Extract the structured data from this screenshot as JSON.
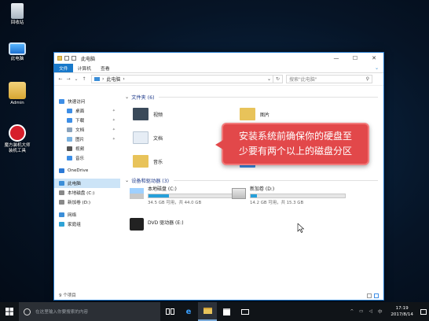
{
  "desktop": {
    "icons": [
      {
        "label": "回收站",
        "icon": "recycle-bin-icon"
      },
      {
        "label": "此电脑",
        "icon": "this-pc-icon"
      },
      {
        "label": "Admin",
        "icon": "user-folder-icon"
      },
      {
        "label": "魔方装机大师\n装机工具",
        "icon": "app-icon"
      }
    ]
  },
  "window": {
    "title": "此电脑",
    "controls": {
      "minimize": "—",
      "maximize": "☐",
      "close": "✕"
    },
    "ribbon_tabs": [
      "文件",
      "计算机",
      "查看"
    ],
    "address": {
      "path_root": "›",
      "path": "此电脑",
      "path_sep": "›"
    },
    "search_placeholder": "搜索\"此电脑\"",
    "nav": {
      "back": "←",
      "forward": "→",
      "up_dropdown": "⌄",
      "up": "↑",
      "refresh": "↻",
      "address_dropdown": "⌄",
      "search_icon": "⚲",
      "ribbon_expand": "⌄"
    },
    "sidebar": [
      {
        "label": "快速访问",
        "level": "root",
        "icon": "star-icon",
        "color": "#3d8ee6"
      },
      {
        "label": "桌面",
        "level": "sub",
        "icon": "desktop-icon",
        "color": "#3d8ee6",
        "pinned": true
      },
      {
        "label": "下载",
        "level": "sub",
        "icon": "download-icon",
        "color": "#3d8ee6",
        "pinned": true
      },
      {
        "label": "文档",
        "level": "sub",
        "icon": "document-icon",
        "color": "#8aa2bb",
        "pinned": true
      },
      {
        "label": "图片",
        "level": "sub",
        "icon": "pictures-icon",
        "color": "#7ab2e0",
        "pinned": true
      },
      {
        "label": "视频",
        "level": "sub",
        "icon": "video-icon",
        "color": "#555"
      },
      {
        "label": "音乐",
        "level": "sub",
        "icon": "music-icon",
        "color": "#3d8ee6"
      },
      {
        "label": "OneDrive",
        "level": "root",
        "icon": "cloud-icon",
        "color": "#2b79d6"
      },
      {
        "label": "此电脑",
        "level": "root",
        "icon": "computer-icon",
        "color": "#3b8ed8",
        "selected": true
      },
      {
        "label": "本地磁盘 (C:)",
        "level": "root",
        "icon": "drive-icon",
        "color": "#888"
      },
      {
        "label": "新加卷 (D:)",
        "level": "root",
        "icon": "drive-icon",
        "color": "#888"
      },
      {
        "label": "网络",
        "level": "root",
        "icon": "network-icon",
        "color": "#3b8ed8"
      },
      {
        "label": "家庭组",
        "level": "root",
        "icon": "homegroup-icon",
        "color": "#2ea3d6"
      }
    ],
    "folders_header": "文件夹 (6)",
    "folders": [
      {
        "label": "视频",
        "icon": "video-folder-icon",
        "color": "#3a4a5a"
      },
      {
        "label": "图片",
        "icon": "pictures-folder-icon",
        "color": "#e8c35a"
      },
      {
        "label": "文档",
        "icon": "documents-folder-icon",
        "color": "#e6edf5"
      },
      {
        "label": "下载",
        "icon": "downloads-folder-icon",
        "color": "#e8c35a"
      },
      {
        "label": "音乐",
        "icon": "music-folder-icon",
        "color": "#e8c35a"
      },
      {
        "label": "桌面",
        "icon": "desktop-folder-icon",
        "color": "#3d8ee6"
      }
    ],
    "drives_header": "设备和驱动器 (3)",
    "drives": [
      {
        "name": "本地磁盘 (C:)",
        "size": "34.5 GB 可用，共 44.0 GB",
        "used_fraction": 0.22,
        "icon": "windows-drive-icon"
      },
      {
        "name": "新加卷 (D:)",
        "size": "14.2 GB 可用，共 15.3 GB",
        "used_fraction": 0.07,
        "icon": "drive-icon"
      },
      {
        "name": "DVD 驱动器 (E:)",
        "icon": "dvd-drive-icon"
      }
    ],
    "status": "9 个项目"
  },
  "overlay": {
    "line1": "安装系统前确保你的硬盘至",
    "line2": "少要有两个以上的磁盘分区"
  },
  "taskbar": {
    "search_placeholder": "在这里输入你要搜索的内容",
    "time": "17:19",
    "date": "2017/8/14",
    "apps": [
      "task-view-icon",
      "edge-icon",
      "file-explorer-icon",
      "store-icon",
      "mail-icon"
    ]
  }
}
